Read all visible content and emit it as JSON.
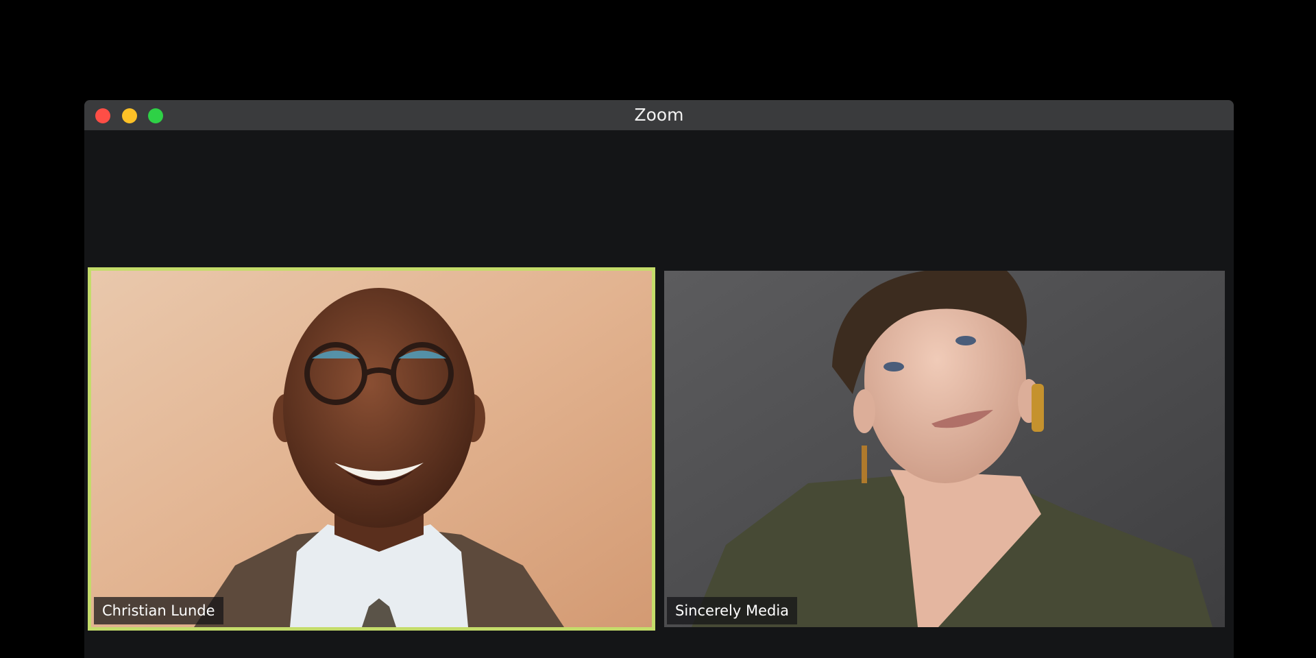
{
  "window": {
    "title": "Zoom",
    "controls": [
      "close",
      "minimize",
      "maximize"
    ]
  },
  "participants": [
    {
      "name": "Christian Lunde",
      "active_speaker": true
    },
    {
      "name": "Sincerely Media",
      "active_speaker": false
    }
  ],
  "colors": {
    "active_speaker_border": "#c4dc6a",
    "window_bg": "#141517",
    "titlebar_bg": "#3a3b3d",
    "close": "#fe4e46",
    "minimize": "#fdc127",
    "maximize": "#2ed146"
  }
}
